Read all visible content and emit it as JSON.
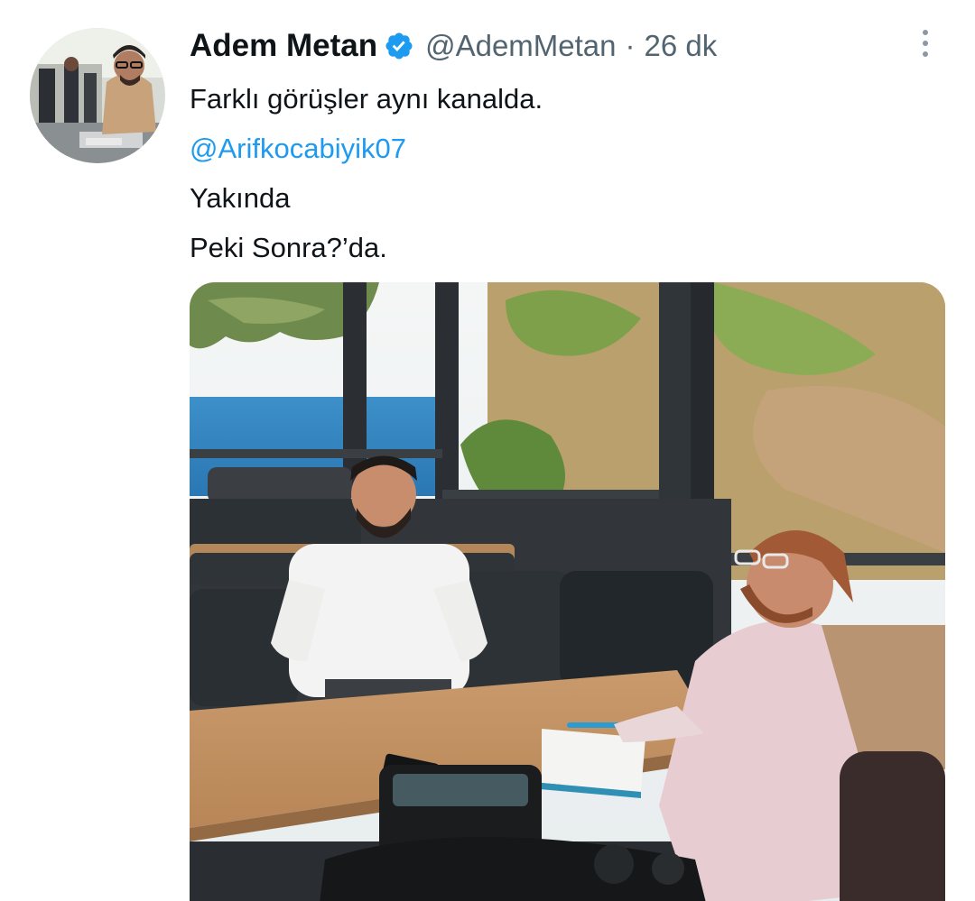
{
  "tweet": {
    "author": {
      "name": "Adem Metan",
      "handle": "@AdemMetan",
      "verified_icon": "verified-badge-icon",
      "avatar_icon": "avatar-photo"
    },
    "separator": "·",
    "timestamp": "26 dk",
    "more_icon": "more-vertical-icon",
    "text_lines": [
      "Farklı görüşler aynı kanalda.",
      "@Arifkocabiyik07",
      "Yakında",
      "Peki Sonra?’da."
    ],
    "media": {
      "type": "photo",
      "icon": "photo-interview-image"
    }
  },
  "colors": {
    "accent": "#1d9bf0",
    "text_primary": "#0f1419",
    "text_secondary": "#536471"
  }
}
